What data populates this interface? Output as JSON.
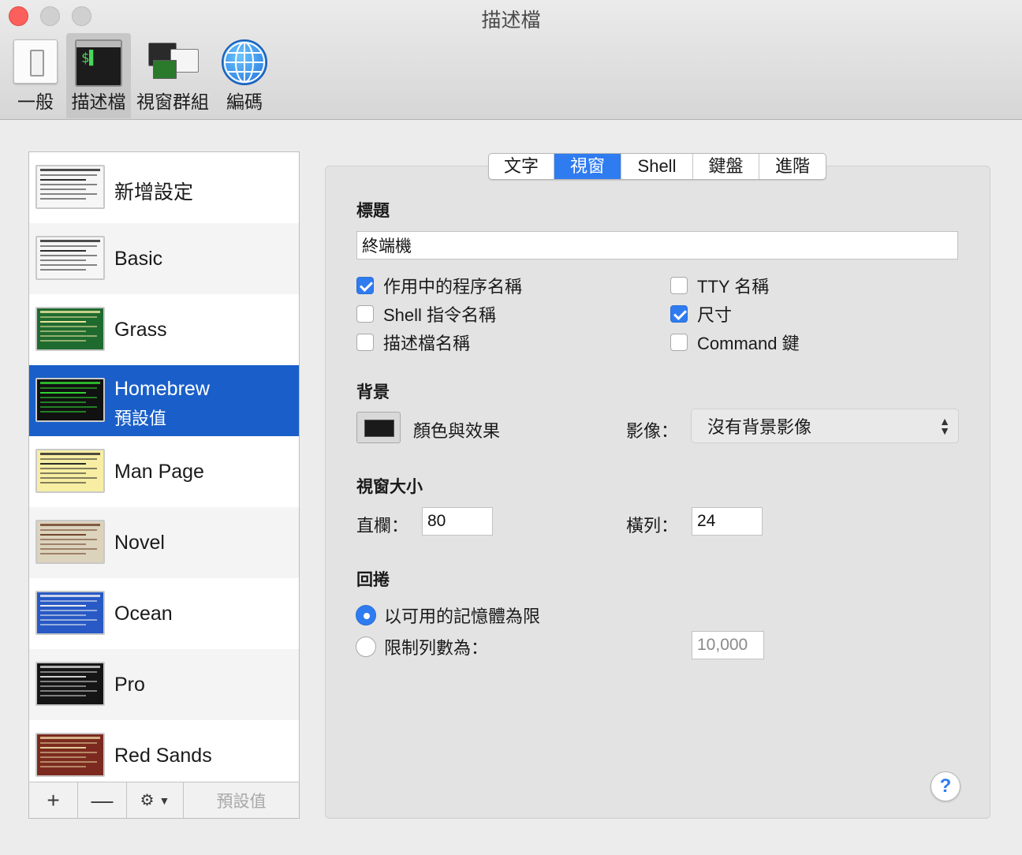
{
  "window": {
    "title": "描述檔"
  },
  "toolbar": {
    "items": [
      {
        "label": "一般",
        "icon": "switch-icon"
      },
      {
        "label": "描述檔",
        "icon": "terminal-icon",
        "selected": true
      },
      {
        "label": "視窗群組",
        "icon": "window-groups-icon"
      },
      {
        "label": "編碼",
        "icon": "globe-icon"
      }
    ]
  },
  "profiles": {
    "items": [
      {
        "name": "新增設定",
        "bg": "#f6f6f6",
        "fg": "#222222"
      },
      {
        "name": "Basic",
        "bg": "#f6f6f6",
        "fg": "#222222"
      },
      {
        "name": "Grass",
        "bg": "#1f6b2f",
        "fg": "#f1e8a0"
      },
      {
        "name": "Homebrew",
        "sub": "預設值",
        "bg": "#111111",
        "fg": "#33dd33",
        "selected": true
      },
      {
        "name": "Man Page",
        "bg": "#f7eea3",
        "fg": "#222222"
      },
      {
        "name": "Novel",
        "bg": "#dcd3bd",
        "fg": "#6b3d23"
      },
      {
        "name": "Ocean",
        "bg": "#2859c5",
        "fg": "#f2f2f2"
      },
      {
        "name": "Pro",
        "bg": "#151515",
        "fg": "#d9d9d9"
      },
      {
        "name": "Red Sands",
        "bg": "#7c2a1f",
        "fg": "#e8d5a0"
      }
    ],
    "footer": {
      "add": "+",
      "remove": "—",
      "default_label": "預設值"
    }
  },
  "tabs": [
    "文字",
    "視窗",
    "Shell",
    "鍵盤",
    "進階"
  ],
  "active_tab": "視窗",
  "title_section": {
    "heading": "標題",
    "value": "終端機",
    "options": [
      {
        "label": "作用中的程序名稱",
        "checked": true
      },
      {
        "label": "Shell 指令名稱",
        "checked": false
      },
      {
        "label": "描述檔名稱",
        "checked": false
      },
      {
        "label": "TTY 名稱",
        "checked": false
      },
      {
        "label": "尺寸",
        "checked": true
      },
      {
        "label": "Command 鍵",
        "checked": false
      }
    ]
  },
  "background": {
    "heading": "背景",
    "color_label": "顏色與效果",
    "image_label": "影像：",
    "image_value": "沒有背景影像"
  },
  "window_size": {
    "heading": "視窗大小",
    "columns_label": "直欄：",
    "columns": "80",
    "rows_label": "橫列：",
    "rows": "24"
  },
  "scrollback": {
    "heading": "回捲",
    "option_memory": "以可用的記憶體為限",
    "option_limit": "限制列數為：",
    "limit_value": "10,000"
  },
  "help": "?"
}
